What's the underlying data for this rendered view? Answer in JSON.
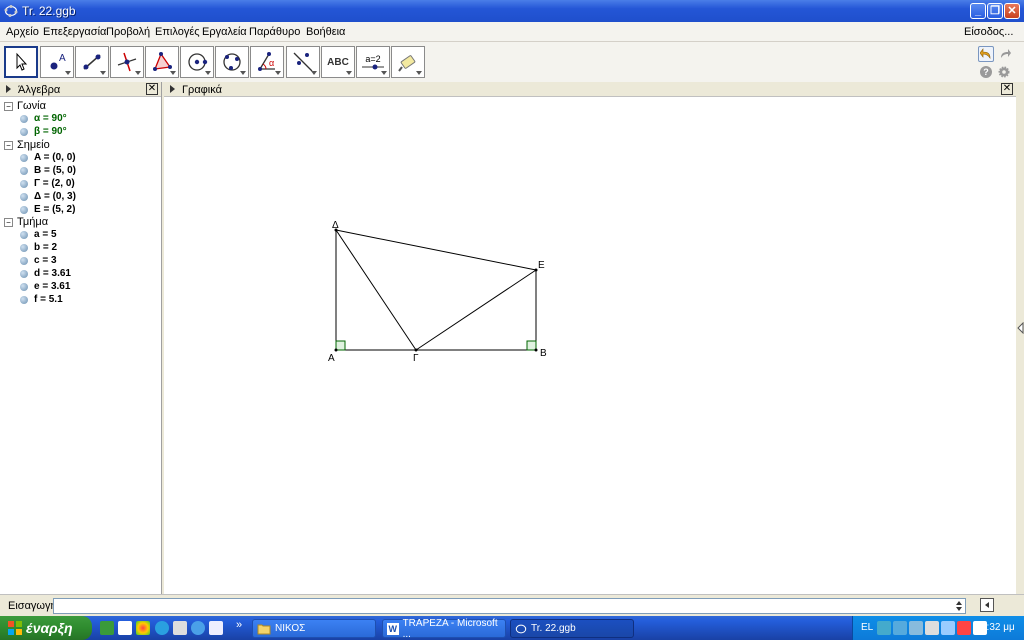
{
  "window": {
    "title": "Tr. 22.ggb",
    "min": "_",
    "max": "❐",
    "close": "✕"
  },
  "menu": {
    "items": [
      "Αρχείο",
      "Επεξεργασία",
      "Προβολή",
      "Επιλογές",
      "Εργαλεία",
      "Παράθυρο",
      "Βοήθεια"
    ],
    "login": "Είσοδος..."
  },
  "toolbar": {
    "tools": [
      "move",
      "point",
      "line",
      "perpendicular-line",
      "polygon",
      "circle",
      "conic",
      "angle",
      "reflect",
      "text",
      "slider",
      "move-graphics-view"
    ],
    "text_tool_label": "ABC",
    "slider_tool_label": "a=2",
    "help": "?"
  },
  "algebra": {
    "title": "Άλγεβρα",
    "close": "✕",
    "categories": [
      {
        "name": "Γωνία",
        "items": [
          "α = 90°",
          "β = 90°"
        ]
      },
      {
        "name": "Σημείο",
        "items": [
          "A = (0, 0)",
          "B = (5, 0)",
          "Γ = (2, 0)",
          "Δ = (0, 3)",
          "E = (5, 2)"
        ]
      },
      {
        "name": "Τμήμα",
        "items": [
          "a = 5",
          "b = 2",
          "c = 3",
          "d = 3.61",
          "e = 3.61",
          "f = 5.1"
        ]
      }
    ]
  },
  "graphics": {
    "title": "Γραφικά",
    "close": "✕",
    "labels": {
      "A": "A",
      "B": "B",
      "G": "Γ",
      "D": "Δ",
      "E": "E"
    }
  },
  "inputbar": {
    "label": "Εισαγωγή:",
    "value": "",
    "placeholder": ""
  },
  "taskbar": {
    "start": "έναρξη",
    "chevron": "»",
    "tasks": [
      "ΝΙΚΟΣ",
      "TRAPEZA - Microsoft ...",
      "Tr. 22.ggb"
    ],
    "lang": "EL",
    "clock": "6:32 μμ"
  },
  "colors": {
    "title_blue": "#245edb",
    "angle_green": "#006400",
    "start_green": "#2e8b2e",
    "tray_blue": "#0f8ee8"
  }
}
